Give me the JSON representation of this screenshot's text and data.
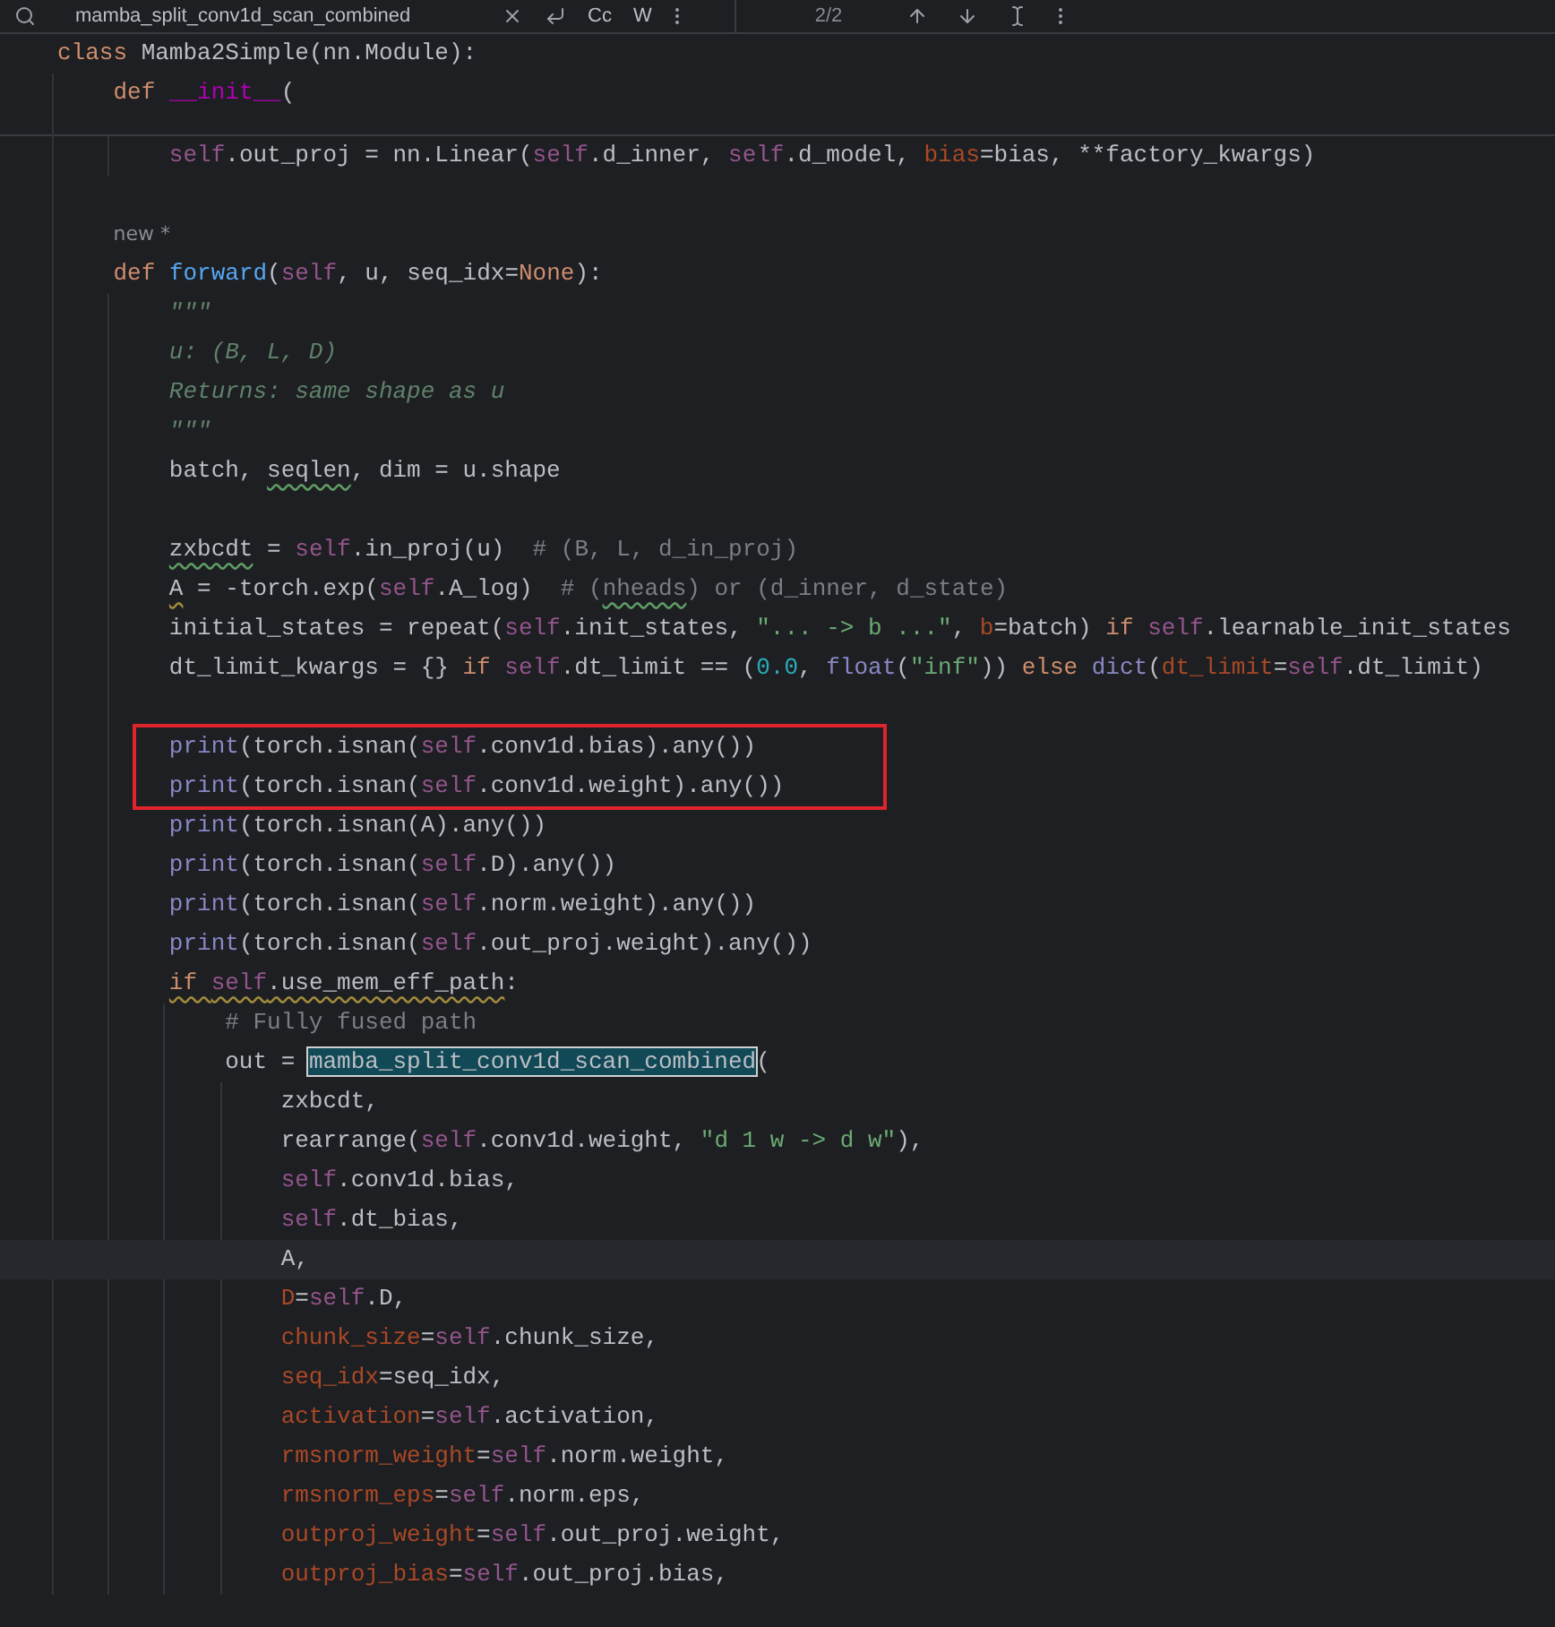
{
  "search": {
    "value": "mamba_split_conv1d_scan_combined",
    "toggles": [
      "Cc",
      "W"
    ],
    "match_count": "2/2"
  },
  "lines": [
    {
      "kind": "code",
      "tokens": [
        {
          "kind": "kw",
          "text": "class"
        },
        {
          "kind": "plain",
          "text": " Mamba2Simple(nn.Module):"
        }
      ]
    },
    {
      "kind": "code",
      "folded": true,
      "tokens": [
        {
          "kind": "kw",
          "text": "    def "
        },
        {
          "kind": "magic",
          "text": "__init__"
        },
        {
          "kind": "plain",
          "text": "("
        }
      ]
    },
    {
      "kind": "code",
      "tokens": [
        {
          "kind": "self",
          "text": "        self"
        },
        {
          "kind": "plain",
          "text": ".out_proj = nn.Linear("
        },
        {
          "kind": "self",
          "text": "self"
        },
        {
          "kind": "plain",
          "text": ".d_inner, "
        },
        {
          "kind": "self",
          "text": "self"
        },
        {
          "kind": "plain",
          "text": ".d_model, "
        },
        {
          "kind": "param",
          "text": "bias"
        },
        {
          "kind": "plain",
          "text": "=bias, **factory_kwargs)"
        }
      ]
    },
    {
      "kind": "blank"
    },
    {
      "kind": "hint",
      "tokens": [
        {
          "kind": "hint",
          "text": "    new *"
        }
      ]
    },
    {
      "kind": "code",
      "tokens": [
        {
          "kind": "kw",
          "text": "    def "
        },
        {
          "kind": "fn",
          "text": "forward"
        },
        {
          "kind": "plain",
          "text": "("
        },
        {
          "kind": "self",
          "text": "self"
        },
        {
          "kind": "plain",
          "text": ", u, seq_idx="
        },
        {
          "kind": "kw",
          "text": "None"
        },
        {
          "kind": "plain",
          "text": "):"
        }
      ]
    },
    {
      "kind": "code",
      "tokens": [
        {
          "kind": "doc",
          "text": "        \"\"\""
        }
      ]
    },
    {
      "kind": "code",
      "tokens": [
        {
          "kind": "doc",
          "text": "        u: (B, L, D)"
        }
      ]
    },
    {
      "kind": "code",
      "tokens": [
        {
          "kind": "doc",
          "text": "        Returns: same shape as u"
        }
      ]
    },
    {
      "kind": "code",
      "tokens": [
        {
          "kind": "doc",
          "text": "        \"\"\""
        }
      ]
    },
    {
      "kind": "code",
      "tokens": [
        {
          "kind": "plain",
          "text": "        batch, "
        },
        {
          "kind": "plain",
          "text": "seqlen",
          "typo": true
        },
        {
          "kind": "plain",
          "text": ", dim = u.shape"
        }
      ]
    },
    {
      "kind": "blank"
    },
    {
      "kind": "code",
      "tokens": [
        {
          "kind": "plain",
          "text": "        zxbcdt",
          "typo": true
        },
        {
          "kind": "plain",
          "text": " = "
        },
        {
          "kind": "self",
          "text": "self"
        },
        {
          "kind": "plain",
          "text": ".in_proj(u)  "
        },
        {
          "kind": "comment",
          "text": "# (B, L, d_in_proj)"
        }
      ]
    },
    {
      "kind": "code",
      "tokens": [
        {
          "kind": "plain",
          "text": "        A",
          "warning": true
        },
        {
          "kind": "plain",
          "text": " = -torch.exp("
        },
        {
          "kind": "self",
          "text": "self"
        },
        {
          "kind": "plain",
          "text": ".A_log)  "
        },
        {
          "kind": "comment",
          "text": "# ("
        },
        {
          "kind": "comment",
          "text": "nheads",
          "typo": true
        },
        {
          "kind": "comment",
          "text": ") or (d_inner, d_state)"
        }
      ]
    },
    {
      "kind": "code",
      "tokens": [
        {
          "kind": "plain",
          "text": "        initial_states = repeat("
        },
        {
          "kind": "self",
          "text": "self"
        },
        {
          "kind": "plain",
          "text": ".init_states, "
        },
        {
          "kind": "str",
          "text": "\"... -> b ...\""
        },
        {
          "kind": "plain",
          "text": ", "
        },
        {
          "kind": "param",
          "text": "b"
        },
        {
          "kind": "plain",
          "text": "=batch) "
        },
        {
          "kind": "kw",
          "text": "if "
        },
        {
          "kind": "self",
          "text": "self"
        },
        {
          "kind": "plain",
          "text": ".learnable_init_states"
        }
      ]
    },
    {
      "kind": "code",
      "tokens": [
        {
          "kind": "plain",
          "text": "        dt_limit_kwargs = {} "
        },
        {
          "kind": "kw",
          "text": "if "
        },
        {
          "kind": "self",
          "text": "self"
        },
        {
          "kind": "plain",
          "text": ".dt_limit == ("
        },
        {
          "kind": "num",
          "text": "0.0"
        },
        {
          "kind": "plain",
          "text": ", "
        },
        {
          "kind": "builtin",
          "text": "float"
        },
        {
          "kind": "plain",
          "text": "("
        },
        {
          "kind": "str",
          "text": "\"inf\""
        },
        {
          "kind": "plain",
          "text": ")) "
        },
        {
          "kind": "kw",
          "text": "else "
        },
        {
          "kind": "builtin",
          "text": "dict"
        },
        {
          "kind": "plain",
          "text": "("
        },
        {
          "kind": "param",
          "text": "dt_limit"
        },
        {
          "kind": "plain",
          "text": "="
        },
        {
          "kind": "self",
          "text": "self"
        },
        {
          "kind": "plain",
          "text": ".dt_limit)"
        }
      ]
    },
    {
      "kind": "blank"
    },
    {
      "kind": "code",
      "boxed": true,
      "tokens": [
        {
          "kind": "builtin",
          "text": "        print"
        },
        {
          "kind": "plain",
          "text": "(torch.isnan("
        },
        {
          "kind": "self",
          "text": "self"
        },
        {
          "kind": "plain",
          "text": ".conv1d.bias).any())"
        }
      ]
    },
    {
      "kind": "code",
      "boxed": true,
      "tokens": [
        {
          "kind": "builtin",
          "text": "        print"
        },
        {
          "kind": "plain",
          "text": "(torch.isnan("
        },
        {
          "kind": "self",
          "text": "self"
        },
        {
          "kind": "plain",
          "text": ".conv1d.weight).any())"
        }
      ]
    },
    {
      "kind": "code",
      "tokens": [
        {
          "kind": "builtin",
          "text": "        print"
        },
        {
          "kind": "plain",
          "text": "(torch.isnan(A).any())"
        }
      ]
    },
    {
      "kind": "code",
      "tokens": [
        {
          "kind": "builtin",
          "text": "        print"
        },
        {
          "kind": "plain",
          "text": "(torch.isnan("
        },
        {
          "kind": "self",
          "text": "self"
        },
        {
          "kind": "plain",
          "text": ".D).any())"
        }
      ]
    },
    {
      "kind": "code",
      "tokens": [
        {
          "kind": "builtin",
          "text": "        print"
        },
        {
          "kind": "plain",
          "text": "(torch.isnan("
        },
        {
          "kind": "self",
          "text": "self"
        },
        {
          "kind": "plain",
          "text": ".norm.weight).any())"
        }
      ]
    },
    {
      "kind": "code",
      "tokens": [
        {
          "kind": "builtin",
          "text": "        print"
        },
        {
          "kind": "plain",
          "text": "(torch.isnan("
        },
        {
          "kind": "self",
          "text": "self"
        },
        {
          "kind": "plain",
          "text": ".out_proj.weight).any())"
        }
      ]
    },
    {
      "kind": "code",
      "tokens": [
        {
          "kind": "kw",
          "text": "        if ",
          "warning": true
        },
        {
          "kind": "self",
          "text": "self",
          "warning": true
        },
        {
          "kind": "plain",
          "text": ".use_mem_eff_path",
          "warning": true
        },
        {
          "kind": "plain",
          "text": ":"
        }
      ]
    },
    {
      "kind": "code",
      "tokens": [
        {
          "kind": "comment",
          "text": "            # Fully fused path"
        }
      ]
    },
    {
      "kind": "code",
      "tokens": [
        {
          "kind": "plain",
          "text": "            out = "
        },
        {
          "kind": "match",
          "text": "mamba_split_conv1d_scan_combined"
        },
        {
          "kind": "plain",
          "text": "("
        }
      ]
    },
    {
      "kind": "code",
      "tokens": [
        {
          "kind": "plain",
          "text": "                zxbcdt,"
        }
      ]
    },
    {
      "kind": "code",
      "tokens": [
        {
          "kind": "plain",
          "text": "                rearrange("
        },
        {
          "kind": "self",
          "text": "self"
        },
        {
          "kind": "plain",
          "text": ".conv1d.weight, "
        },
        {
          "kind": "str",
          "text": "\"d 1 w -> d w\""
        },
        {
          "kind": "plain",
          "text": "),"
        }
      ]
    },
    {
      "kind": "code",
      "tokens": [
        {
          "kind": "self",
          "text": "                self"
        },
        {
          "kind": "plain",
          "text": ".conv1d.bias,"
        }
      ]
    },
    {
      "kind": "code",
      "tokens": [
        {
          "kind": "self",
          "text": "                self"
        },
        {
          "kind": "plain",
          "text": ".dt_bias,"
        }
      ]
    },
    {
      "kind": "code",
      "current": true,
      "tokens": [
        {
          "kind": "plain",
          "text": "                A,"
        }
      ]
    },
    {
      "kind": "code",
      "tokens": [
        {
          "kind": "param",
          "text": "                D"
        },
        {
          "kind": "plain",
          "text": "="
        },
        {
          "kind": "self",
          "text": "self"
        },
        {
          "kind": "plain",
          "text": ".D,"
        }
      ]
    },
    {
      "kind": "code",
      "tokens": [
        {
          "kind": "param",
          "text": "                chunk_size"
        },
        {
          "kind": "plain",
          "text": "="
        },
        {
          "kind": "self",
          "text": "self"
        },
        {
          "kind": "plain",
          "text": ".chunk_size,"
        }
      ]
    },
    {
      "kind": "code",
      "tokens": [
        {
          "kind": "param",
          "text": "                seq_idx"
        },
        {
          "kind": "plain",
          "text": "=seq_idx,"
        }
      ]
    },
    {
      "kind": "code",
      "tokens": [
        {
          "kind": "param",
          "text": "                activation"
        },
        {
          "kind": "plain",
          "text": "="
        },
        {
          "kind": "self",
          "text": "self"
        },
        {
          "kind": "plain",
          "text": ".activation,"
        }
      ]
    },
    {
      "kind": "code",
      "tokens": [
        {
          "kind": "param",
          "text": "                rmsnorm_weight"
        },
        {
          "kind": "plain",
          "text": "="
        },
        {
          "kind": "self",
          "text": "self"
        },
        {
          "kind": "plain",
          "text": ".norm.weight,"
        }
      ]
    },
    {
      "kind": "code",
      "tokens": [
        {
          "kind": "param",
          "text": "                rmsnorm_eps"
        },
        {
          "kind": "plain",
          "text": "="
        },
        {
          "kind": "self",
          "text": "self"
        },
        {
          "kind": "plain",
          "text": ".norm.eps,"
        }
      ]
    },
    {
      "kind": "code",
      "tokens": [
        {
          "kind": "param",
          "text": "                outproj_weight"
        },
        {
          "kind": "plain",
          "text": "="
        },
        {
          "kind": "self",
          "text": "self"
        },
        {
          "kind": "plain",
          "text": ".out_proj.weight,"
        }
      ]
    },
    {
      "kind": "code",
      "tokens": [
        {
          "kind": "param",
          "text": "                outproj_bias"
        },
        {
          "kind": "plain",
          "text": "="
        },
        {
          "kind": "self",
          "text": "self"
        },
        {
          "kind": "plain",
          "text": ".out_proj.bias,"
        }
      ]
    }
  ]
}
